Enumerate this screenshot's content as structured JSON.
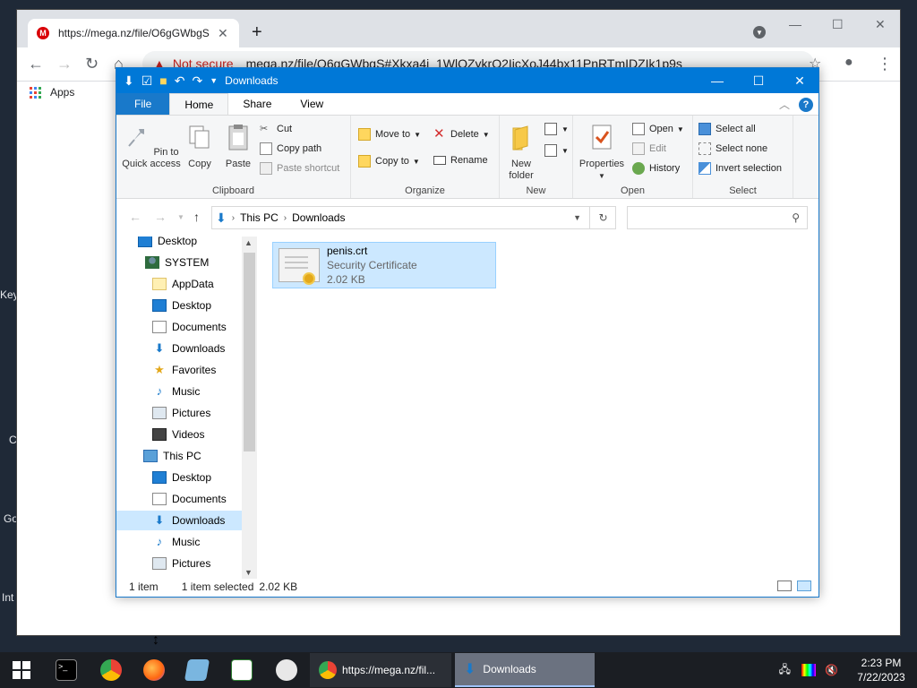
{
  "desktop": {
    "side_labels": [
      "Key",
      "C",
      "Go",
      "Int"
    ]
  },
  "chrome": {
    "tab_title": "https://mega.nz/file/O6gGWbgS",
    "favicon_letter": "M",
    "new_tab": "+",
    "security_label": "Not secure",
    "url": "mega.nz/file/O6gGWbgS#Xkxa4i_1WlOZykrO2IicXoJ44bx11PnRTmIDZIk1p9s",
    "bookmarks": {
      "apps_label": "Apps"
    }
  },
  "explorer": {
    "title": "Downloads",
    "ribbon_tabs": [
      "File",
      "Home",
      "Share",
      "View"
    ],
    "ribbon": {
      "clipboard": {
        "label": "Clipboard",
        "pin": "Pin to Quick access",
        "copy": "Copy",
        "paste": "Paste",
        "cut": "Cut",
        "copy_path": "Copy path",
        "paste_shortcut": "Paste shortcut"
      },
      "organize": {
        "label": "Organize",
        "move_to": "Move to",
        "copy_to": "Copy to",
        "delete": "Delete",
        "rename": "Rename"
      },
      "new": {
        "label": "New",
        "new_folder": "New folder"
      },
      "open": {
        "label": "Open",
        "properties": "Properties",
        "open": "Open",
        "edit": "Edit",
        "history": "History"
      },
      "select": {
        "label": "Select",
        "select_all": "Select all",
        "select_none": "Select none",
        "invert_selection": "Invert selection"
      }
    },
    "address": {
      "crumbs": [
        "This PC",
        "Downloads"
      ]
    },
    "search": {
      "placeholder": ""
    },
    "nav_pane": [
      {
        "label": "Desktop",
        "icon": "desktop-icon"
      },
      {
        "label": "SYSTEM",
        "icon": "user-icon"
      },
      {
        "label": "AppData",
        "icon": "folder-icon"
      },
      {
        "label": "Desktop",
        "icon": "desktop-icon"
      },
      {
        "label": "Documents",
        "icon": "documents-icon"
      },
      {
        "label": "Downloads",
        "icon": "downloads-icon"
      },
      {
        "label": "Favorites",
        "icon": "star-icon"
      },
      {
        "label": "Music",
        "icon": "music-icon"
      },
      {
        "label": "Pictures",
        "icon": "pictures-icon"
      },
      {
        "label": "Videos",
        "icon": "videos-icon"
      },
      {
        "label": "This PC",
        "icon": "computer-icon"
      },
      {
        "label": "Desktop",
        "icon": "desktop-icon"
      },
      {
        "label": "Documents",
        "icon": "documents-icon"
      },
      {
        "label": "Downloads",
        "icon": "downloads-icon"
      },
      {
        "label": "Music",
        "icon": "music-icon"
      },
      {
        "label": "Pictures",
        "icon": "pictures-icon"
      }
    ],
    "files": [
      {
        "name": "penis.crt",
        "type": "Security Certificate",
        "size": "2.02 KB",
        "icon": "certificate-icon"
      }
    ],
    "status": {
      "count": "1 item",
      "selected": "1 item selected",
      "size": "2.02 KB"
    }
  },
  "taskbar": {
    "tasks": [
      {
        "label": "https://mega.nz/fil...",
        "icon": "chrome-icon"
      },
      {
        "label": "Downloads",
        "icon": "downloads-icon"
      }
    ],
    "clock": {
      "time": "2:23 PM",
      "date": "7/22/2023"
    }
  },
  "colors": {
    "titlebar": "#0078d7",
    "selection": "#cce8ff",
    "taskbar": "#1b1e23"
  }
}
